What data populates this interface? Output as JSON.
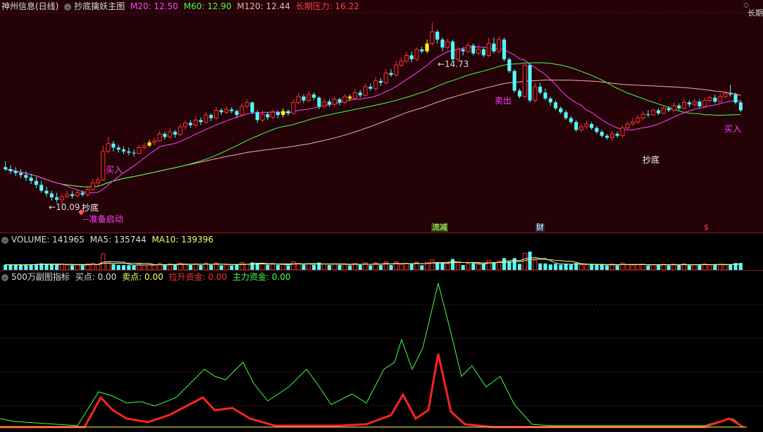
{
  "main": {
    "title": "神州信息(日线)",
    "indicator": "抄底擒妖主图",
    "ma20_label": "M20: 12.50",
    "ma60_label": "M60: 12.90",
    "ma120_label": "M120: 12.44",
    "long_pressure_label": "长期压力: 16.22",
    "corner_text": "长期",
    "high_price_label": "14.73",
    "low_price_label": "10.09",
    "buy_label_1": "买入",
    "buy_label_2": "买入",
    "sell_label": "卖出",
    "bottom_label_1": "抄底",
    "bottom_label_2": "抄底",
    "ready_label": "准备启动",
    "events": [
      "流减",
      "财",
      "$"
    ],
    "colors": {
      "up": "#ff3232",
      "down": "#54fcfc",
      "ma20": "#ff44ff",
      "ma60": "#44ff44",
      "ma120": "#ffaaaa",
      "signal": "#ffff00"
    }
  },
  "volume": {
    "label": "VOLUME: 141965",
    "ma5_label": "MA5: 135744",
    "ma10_label": "MA10: 139396"
  },
  "indicator": {
    "name": "500万副图指标",
    "buy_label": "买点: 0.00",
    "sell_label": "卖点: 0.00",
    "lift_label": "拉升资金: 0.00",
    "main_label": "主力资金: 0.00"
  },
  "chart_data": {
    "type": "candlestick",
    "price_range": [
      10.09,
      14.73
    ],
    "ohlc": [
      [
        11.05,
        11.0,
        11.2,
        10.95
      ],
      [
        11.0,
        10.95,
        11.1,
        10.88
      ],
      [
        10.95,
        10.9,
        11.05,
        10.82
      ],
      [
        10.9,
        10.85,
        11.0,
        10.78
      ],
      [
        10.85,
        10.78,
        10.95,
        10.7
      ],
      [
        10.78,
        10.7,
        10.88,
        10.62
      ],
      [
        10.7,
        10.6,
        10.8,
        10.52
      ],
      [
        10.6,
        10.45,
        10.7,
        10.4
      ],
      [
        10.45,
        10.38,
        10.55,
        10.3
      ],
      [
        10.38,
        10.28,
        10.45,
        10.2
      ],
      [
        10.28,
        10.22,
        10.4,
        10.15
      ],
      [
        10.22,
        10.3,
        10.38,
        10.09
      ],
      [
        10.3,
        10.36,
        10.45,
        10.25
      ],
      [
        10.36,
        10.32,
        10.44,
        10.25
      ],
      [
        10.32,
        10.4,
        10.48,
        10.28
      ],
      [
        10.4,
        10.35,
        10.46,
        10.3
      ],
      [
        10.35,
        10.48,
        10.56,
        10.3
      ],
      [
        10.48,
        10.65,
        10.75,
        10.45
      ],
      [
        10.65,
        10.72,
        10.8,
        10.58
      ],
      [
        10.72,
        11.45,
        11.6,
        10.7
      ],
      [
        11.45,
        11.65,
        11.82,
        11.4
      ],
      [
        11.65,
        11.55,
        11.72,
        11.45
      ],
      [
        11.55,
        11.5,
        11.62,
        11.42
      ],
      [
        11.5,
        11.45,
        11.58,
        11.38
      ],
      [
        11.45,
        11.42,
        11.55,
        11.35
      ],
      [
        11.42,
        11.4,
        11.5,
        11.32
      ],
      [
        11.4,
        11.55,
        11.62,
        11.38
      ],
      [
        11.55,
        11.6,
        11.68,
        11.5
      ],
      [
        11.6,
        11.68,
        11.75,
        11.55
      ],
      [
        11.68,
        11.72,
        11.8,
        11.6
      ],
      [
        11.72,
        11.9,
        11.98,
        11.7
      ],
      [
        11.9,
        11.82,
        11.95,
        11.75
      ],
      [
        11.82,
        11.95,
        12.05,
        11.78
      ],
      [
        11.95,
        11.88,
        12.0,
        11.8
      ],
      [
        11.88,
        12.08,
        12.15,
        11.85
      ],
      [
        12.08,
        12.18,
        12.25,
        12.0
      ],
      [
        12.18,
        12.12,
        12.25,
        12.05
      ],
      [
        12.12,
        12.25,
        12.35,
        12.08
      ],
      [
        12.25,
        12.2,
        12.32,
        12.12
      ],
      [
        12.2,
        12.38,
        12.45,
        12.15
      ],
      [
        12.38,
        12.3,
        12.42,
        12.22
      ],
      [
        12.3,
        12.5,
        12.58,
        12.25
      ],
      [
        12.5,
        12.45,
        12.55,
        12.38
      ],
      [
        12.45,
        12.52,
        12.6,
        12.4
      ],
      [
        12.52,
        12.48,
        12.58,
        12.42
      ],
      [
        12.48,
        12.38,
        12.52,
        12.3
      ],
      [
        12.38,
        12.6,
        12.68,
        12.35
      ],
      [
        12.6,
        12.7,
        12.78,
        12.55
      ],
      [
        12.7,
        12.45,
        12.72,
        12.4
      ],
      [
        12.45,
        12.25,
        12.5,
        12.18
      ],
      [
        12.25,
        12.4,
        12.48,
        12.2
      ],
      [
        12.4,
        12.32,
        12.45,
        12.25
      ],
      [
        12.32,
        12.45,
        12.52,
        12.28
      ],
      [
        12.45,
        12.38,
        12.5,
        12.3
      ],
      [
        12.38,
        12.48,
        12.55,
        12.32
      ],
      [
        12.48,
        12.42,
        12.52,
        12.36
      ],
      [
        12.42,
        12.7,
        12.78,
        12.4
      ],
      [
        12.7,
        12.85,
        12.95,
        12.65
      ],
      [
        12.85,
        12.75,
        12.9,
        12.68
      ],
      [
        12.75,
        12.9,
        12.98,
        12.7
      ],
      [
        12.9,
        12.82,
        12.95,
        12.75
      ],
      [
        12.82,
        12.6,
        12.86,
        12.52
      ],
      [
        12.6,
        12.72,
        12.8,
        12.55
      ],
      [
        12.72,
        12.65,
        12.78,
        12.58
      ],
      [
        12.65,
        12.78,
        12.85,
        12.6
      ],
      [
        12.78,
        12.7,
        12.82,
        12.62
      ],
      [
        12.7,
        12.85,
        12.92,
        12.66
      ],
      [
        12.85,
        12.8,
        12.9,
        12.74
      ],
      [
        12.8,
        12.95,
        13.05,
        12.76
      ],
      [
        12.95,
        12.88,
        13.02,
        12.82
      ],
      [
        12.88,
        13.1,
        13.18,
        12.85
      ],
      [
        13.1,
        13.05,
        13.18,
        13.0
      ],
      [
        13.05,
        13.25,
        13.35,
        13.0
      ],
      [
        13.25,
        13.2,
        13.32,
        13.12
      ],
      [
        13.2,
        13.45,
        13.55,
        13.15
      ],
      [
        13.45,
        13.4,
        13.55,
        13.35
      ],
      [
        13.4,
        13.65,
        13.75,
        13.35
      ],
      [
        13.65,
        13.75,
        13.85,
        13.6
      ],
      [
        13.75,
        13.9,
        14.0,
        13.7
      ],
      [
        13.9,
        13.8,
        14.0,
        13.72
      ],
      [
        13.8,
        14.05,
        14.1,
        13.75
      ],
      [
        14.05,
        14.0,
        14.12,
        13.95
      ],
      [
        14.0,
        14.2,
        14.3,
        13.95
      ],
      [
        14.2,
        14.5,
        14.73,
        14.15
      ],
      [
        14.5,
        14.3,
        14.55,
        14.2
      ],
      [
        14.3,
        14.1,
        14.35,
        14.0
      ],
      [
        14.1,
        14.25,
        14.32,
        14.05
      ],
      [
        14.25,
        13.8,
        14.3,
        13.75
      ],
      [
        13.8,
        14.05,
        14.12,
        13.75
      ],
      [
        14.05,
        14.0,
        14.1,
        13.9
      ],
      [
        14.0,
        14.15,
        14.22,
        13.95
      ],
      [
        14.15,
        13.95,
        14.2,
        13.9
      ],
      [
        13.95,
        14.05,
        14.15,
        13.9
      ],
      [
        14.05,
        13.9,
        14.1,
        13.85
      ],
      [
        13.9,
        14.2,
        14.35,
        13.85
      ],
      [
        14.2,
        14.0,
        14.35,
        13.95
      ],
      [
        14.0,
        14.3,
        14.38,
        13.95
      ],
      [
        14.3,
        13.8,
        14.35,
        13.75
      ],
      [
        13.8,
        13.5,
        13.85,
        13.45
      ],
      [
        13.5,
        13.0,
        13.55,
        12.95
      ],
      [
        13.0,
        12.85,
        13.05,
        12.8
      ],
      [
        12.85,
        13.65,
        13.7,
        12.8
      ],
      [
        13.65,
        12.75,
        13.7,
        12.7
      ],
      [
        12.75,
        13.1,
        13.2,
        12.7
      ],
      [
        13.1,
        12.95,
        13.2,
        12.9
      ],
      [
        12.95,
        12.8,
        13.05,
        12.75
      ],
      [
        12.8,
        12.7,
        12.85,
        12.62
      ],
      [
        12.7,
        12.55,
        12.75,
        12.5
      ],
      [
        12.55,
        12.45,
        12.6,
        12.4
      ],
      [
        12.45,
        12.3,
        12.5,
        12.25
      ],
      [
        12.3,
        12.2,
        12.35,
        12.15
      ],
      [
        12.2,
        12.0,
        12.25,
        11.95
      ],
      [
        12.0,
        12.08,
        12.15,
        11.95
      ],
      [
        12.08,
        12.15,
        12.22,
        12.02
      ],
      [
        12.15,
        12.05,
        12.2,
        12.0
      ],
      [
        12.05,
        11.95,
        12.1,
        11.9
      ],
      [
        11.95,
        11.85,
        12.0,
        11.8
      ],
      [
        11.85,
        11.8,
        11.9,
        11.75
      ],
      [
        11.8,
        11.9,
        11.98,
        11.72
      ],
      [
        11.9,
        11.85,
        11.95,
        11.8
      ],
      [
        11.85,
        12.05,
        12.12,
        11.82
      ],
      [
        12.05,
        12.15,
        12.22,
        12.0
      ],
      [
        12.15,
        12.2,
        12.3,
        12.1
      ],
      [
        12.2,
        12.3,
        12.38,
        12.15
      ],
      [
        12.3,
        12.4,
        12.48,
        12.25
      ],
      [
        12.4,
        12.38,
        12.5,
        12.32
      ],
      [
        12.38,
        12.5,
        12.55,
        12.35
      ],
      [
        12.5,
        12.42,
        12.55,
        12.38
      ],
      [
        12.42,
        12.55,
        12.62,
        12.4
      ],
      [
        12.55,
        12.5,
        12.6,
        12.45
      ],
      [
        12.5,
        12.62,
        12.7,
        12.45
      ],
      [
        12.62,
        12.55,
        12.68,
        12.5
      ],
      [
        12.55,
        12.7,
        12.78,
        12.52
      ],
      [
        12.7,
        12.65,
        12.75,
        12.58
      ],
      [
        12.65,
        12.72,
        12.8,
        12.6
      ],
      [
        12.72,
        12.6,
        12.78,
        12.55
      ],
      [
        12.6,
        12.75,
        12.82,
        12.58
      ],
      [
        12.75,
        12.82,
        12.88,
        12.7
      ],
      [
        12.82,
        12.72,
        12.9,
        12.68
      ],
      [
        12.72,
        12.85,
        12.92,
        12.7
      ],
      [
        12.85,
        12.92,
        13.0,
        12.8
      ],
      [
        12.92,
        12.9,
        13.15,
        12.85
      ],
      [
        12.9,
        12.7,
        12.95,
        12.65
      ],
      [
        12.7,
        12.5,
        12.75,
        12.45
      ]
    ],
    "volume": [],
    "lines": {
      "ma20": 12.5,
      "ma60": 12.9,
      "ma120": 12.44
    }
  }
}
